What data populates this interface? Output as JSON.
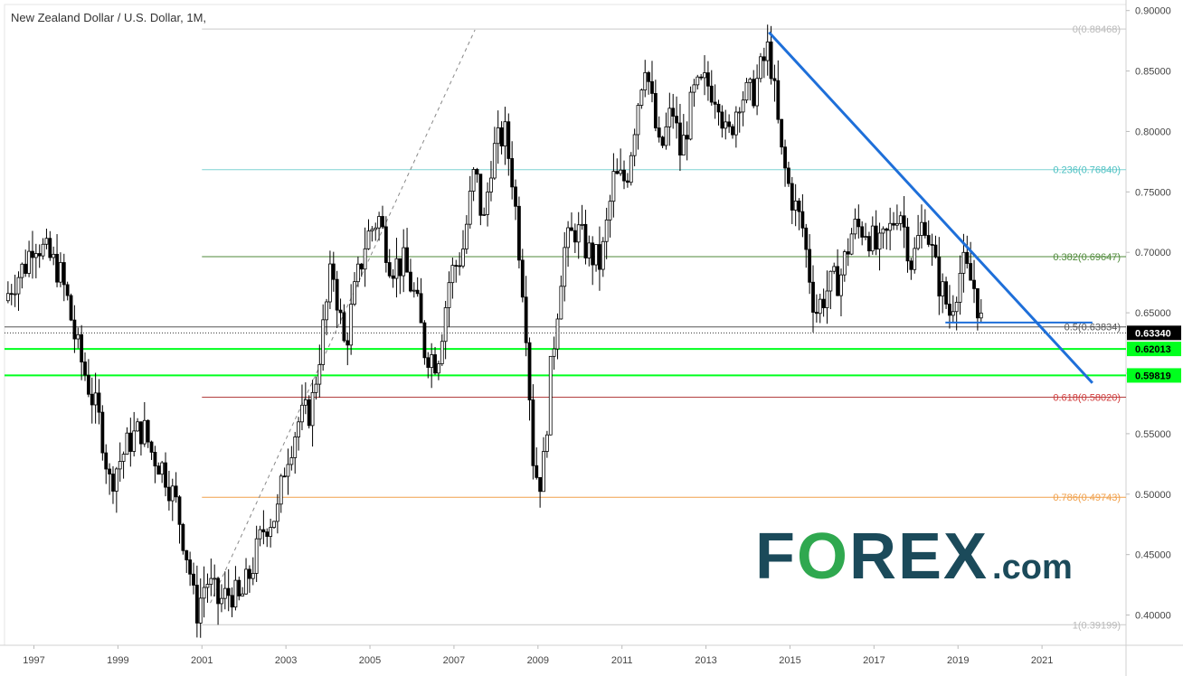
{
  "header": {
    "title": "New Zealand Dollar / U.S. Dollar, 1M,"
  },
  "logo": {
    "text_before": "F",
    "text_o": "O",
    "text_after": "REX",
    "suffix": ".com"
  },
  "colors": {
    "candle_up": "#ffffff",
    "candle_down": "#000000",
    "candle_border": "#000000",
    "trendline": "#1e6fd9",
    "support": "#00ff1e",
    "logo_primary": "#1b4a5a",
    "logo_accent": "#2fa84f"
  },
  "chart_data": {
    "type": "candlestick",
    "title": "New Zealand Dollar / U.S. Dollar, 1M,",
    "x_axis": {
      "type": "time",
      "range": [
        1996.3,
        2023.0
      ],
      "tick_labels": [
        "1997",
        "1999",
        "2001",
        "2003",
        "2005",
        "2007",
        "2009",
        "2011",
        "2013",
        "2015",
        "2017",
        "2019",
        "2021"
      ]
    },
    "y_axis": {
      "position": "right",
      "range": [
        0.375,
        0.905
      ],
      "tick_labels": [
        "0.90000",
        "0.85000",
        "0.80000",
        "0.75000",
        "0.70000",
        "0.65000",
        "0.60000",
        "0.55000",
        "0.50000",
        "0.45000",
        "0.40000"
      ]
    },
    "close_path": [
      [
        1996.3,
        0.66
      ],
      [
        1996.5,
        0.675
      ],
      [
        1996.8,
        0.69
      ],
      [
        1997.0,
        0.712
      ],
      [
        1997.3,
        0.698
      ],
      [
        1997.6,
        0.685
      ],
      [
        1997.8,
        0.66
      ],
      [
        1998.0,
        0.625
      ],
      [
        1998.3,
        0.59
      ],
      [
        1998.6,
        0.555
      ],
      [
        1998.8,
        0.51
      ],
      [
        1999.0,
        0.525
      ],
      [
        1999.3,
        0.545
      ],
      [
        1999.6,
        0.555
      ],
      [
        1999.8,
        0.535
      ],
      [
        2000.1,
        0.52
      ],
      [
        2000.4,
        0.49
      ],
      [
        2000.7,
        0.44
      ],
      [
        2000.85,
        0.4
      ],
      [
        2001.1,
        0.43
      ],
      [
        2001.4,
        0.41
      ],
      [
        2001.7,
        0.42
      ],
      [
        2001.9,
        0.41
      ],
      [
        2002.2,
        0.44
      ],
      [
        2002.5,
        0.475
      ],
      [
        2002.8,
        0.485
      ],
      [
        2003.0,
        0.53
      ],
      [
        2003.3,
        0.56
      ],
      [
        2003.6,
        0.57
      ],
      [
        2003.9,
        0.64
      ],
      [
        2004.1,
        0.69
      ],
      [
        2004.4,
        0.62
      ],
      [
        2004.6,
        0.66
      ],
      [
        2004.9,
        0.71
      ],
      [
        2005.2,
        0.73
      ],
      [
        2005.5,
        0.69
      ],
      [
        2005.8,
        0.69
      ],
      [
        2006.1,
        0.66
      ],
      [
        2006.3,
        0.62
      ],
      [
        2006.6,
        0.61
      ],
      [
        2006.9,
        0.68
      ],
      [
        2007.2,
        0.7
      ],
      [
        2007.5,
        0.77
      ],
      [
        2007.7,
        0.72
      ],
      [
        2007.9,
        0.78
      ],
      [
        2008.2,
        0.8
      ],
      [
        2008.4,
        0.76
      ],
      [
        2008.7,
        0.65
      ],
      [
        2008.9,
        0.52
      ],
      [
        2009.1,
        0.51
      ],
      [
        2009.3,
        0.6
      ],
      [
        2009.6,
        0.7
      ],
      [
        2009.9,
        0.72
      ],
      [
        2010.2,
        0.7
      ],
      [
        2010.5,
        0.69
      ],
      [
        2010.8,
        0.76
      ],
      [
        2011.1,
        0.76
      ],
      [
        2011.4,
        0.83
      ],
      [
        2011.55,
        0.86
      ],
      [
        2011.9,
        0.78
      ],
      [
        2012.2,
        0.82
      ],
      [
        2012.4,
        0.78
      ],
      [
        2012.7,
        0.83
      ],
      [
        2013.0,
        0.84
      ],
      [
        2013.3,
        0.83
      ],
      [
        2013.5,
        0.79
      ],
      [
        2013.8,
        0.83
      ],
      [
        2014.1,
        0.83
      ],
      [
        2014.5,
        0.87
      ],
      [
        2014.8,
        0.78
      ],
      [
        2015.0,
        0.75
      ],
      [
        2015.3,
        0.72
      ],
      [
        2015.6,
        0.65
      ],
      [
        2015.9,
        0.67
      ],
      [
        2016.2,
        0.68
      ],
      [
        2016.5,
        0.72
      ],
      [
        2016.8,
        0.72
      ],
      [
        2017.1,
        0.7
      ],
      [
        2017.4,
        0.72
      ],
      [
        2017.6,
        0.74
      ],
      [
        2017.9,
        0.69
      ],
      [
        2018.2,
        0.73
      ],
      [
        2018.5,
        0.68
      ],
      [
        2018.8,
        0.65
      ],
      [
        2019.1,
        0.69
      ],
      [
        2019.4,
        0.67
      ],
      [
        2019.6,
        0.633
      ]
    ],
    "fibonacci": [
      {
        "ratio": 0,
        "label": "0(0.88468)",
        "price": 0.88468,
        "color": "#c9c9c9",
        "text_color": "#b9b9b9"
      },
      {
        "ratio": 0.236,
        "label": "0.236(0.76840)",
        "price": 0.7684,
        "color": "#7fd3d4",
        "text_color": "#4cc0c2"
      },
      {
        "ratio": 0.382,
        "label": "0.382(0.69647)",
        "price": 0.69647,
        "color": "#4f8a3a",
        "text_color": "#4f8a3a"
      },
      {
        "ratio": 0.5,
        "label": "0.5(0.63834)",
        "price": 0.63834,
        "color": "#555555",
        "text_color": "#555555"
      },
      {
        "ratio": 0.618,
        "label": "0.618(0.58020)",
        "price": 0.5802,
        "color": "#b34040",
        "text_color": "#d13a3a"
      },
      {
        "ratio": 0.786,
        "label": "0.786(0.49743)",
        "price": 0.49743,
        "color": "#f0a04b",
        "text_color": "#f0a04b"
      },
      {
        "ratio": 1,
        "label": "1(0.39199)",
        "price": 0.39199,
        "color": "#c9c9c9",
        "text_color": "#b9b9b9"
      }
    ],
    "price_markers": [
      {
        "label": "0.63340",
        "price": 0.6334,
        "bg": "#000000",
        "fg": "#ffffff"
      },
      {
        "label": "0.62013",
        "price": 0.62013,
        "bg": "#00ff1e",
        "fg": "#000000"
      },
      {
        "label": "0.59819",
        "price": 0.59819,
        "bg": "#00ff1e",
        "fg": "#000000"
      }
    ],
    "support_lines": [
      0.62013,
      0.59819
    ],
    "trendline": {
      "from": [
        2014.5,
        0.882
      ],
      "to": [
        2022.2,
        0.592
      ]
    },
    "horizontal_segment": {
      "from": [
        2018.7,
        0.642
      ],
      "to": [
        2022.2,
        0.642
      ]
    },
    "dashed_guide": {
      "from": [
        2001.2,
        0.41
      ],
      "to": [
        2007.5,
        0.884
      ]
    }
  }
}
